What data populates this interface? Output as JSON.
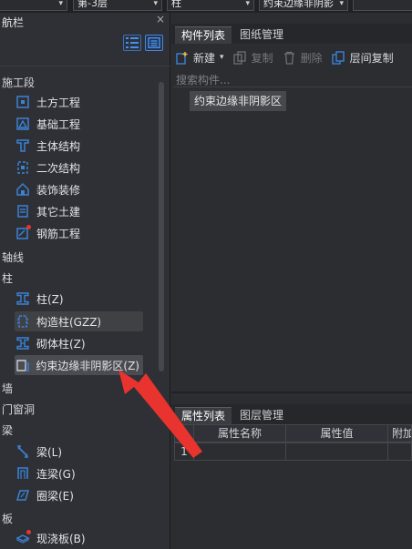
{
  "topbar": {
    "floor_select": "第-3层",
    "category_select": "柱",
    "type_select": "约束边缘非阴影"
  },
  "nav": {
    "title": "航栏",
    "close": "×",
    "groups": {
      "construction": "施工段",
      "axis": "轴线",
      "column": "柱",
      "wall": "墙",
      "door_window": "门窗洞",
      "beam": "梁",
      "slab": "板"
    },
    "construction_items": [
      {
        "label": "土方工程"
      },
      {
        "label": "基础工程"
      },
      {
        "label": "主体结构"
      },
      {
        "label": "二次结构"
      },
      {
        "label": "装饰装修"
      },
      {
        "label": "其它土建"
      },
      {
        "label": "钢筋工程"
      }
    ],
    "column_items": [
      {
        "label": "柱(Z)"
      },
      {
        "label": "构造柱(GZZ)"
      },
      {
        "label": "砌体柱(Z)"
      },
      {
        "label": "约束边缘非阴影区(Z)"
      }
    ],
    "beam_items": [
      {
        "label": "梁(L)"
      },
      {
        "label": "连梁(G)"
      },
      {
        "label": "圈梁(E)"
      }
    ],
    "slab_items": [
      {
        "label": "现浇板(B)"
      }
    ]
  },
  "component_panel": {
    "tabs": [
      "构件列表",
      "图纸管理"
    ],
    "toolbar": {
      "new": "新建",
      "copy": "复制",
      "delete": "删除",
      "floor_copy": "层间复制"
    },
    "search_placeholder": "搜索构件...",
    "items": [
      "约束边缘非阴影区"
    ]
  },
  "property_panel": {
    "tabs": [
      "属性列表",
      "图层管理"
    ],
    "columns": [
      "属性名称",
      "属性值",
      "附加"
    ],
    "rows": [
      {
        "index": "1",
        "name": "",
        "value": "",
        "extra": ""
      }
    ]
  },
  "colors": {
    "accent": "#3b82d6",
    "arrow": "#e8332e"
  }
}
